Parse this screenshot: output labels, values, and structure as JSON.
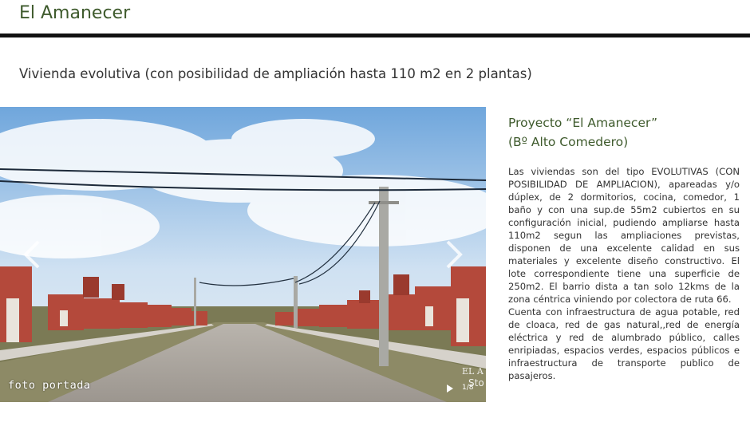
{
  "header": {
    "title": "El Amanecer"
  },
  "subtitle": "Vivienda evolutiva (con posibilidad de ampliación hasta 110 m2 en 2 plantas)",
  "slider": {
    "caption": "foto portada",
    "counter": "1/8",
    "watermark_text": "EL A Sto",
    "prev_icon": "chevron-left-icon",
    "next_icon": "chevron-right-icon",
    "play_icon": "play-icon"
  },
  "project": {
    "title_line1": "Proyecto “El Amanecer”",
    "title_line2": "(Bº Alto Comedero)",
    "paragraph1": "Las viviendas son del tipo EVOLUTIVAS (CON POSIBILIDAD DE AMPLIACION), apareadas y/o dúplex, de 2 dormitorios, cocina, comedor, 1 baño y con una sup.de 55m2 cubiertos en su configuración inicial, pudiendo ampliarse hasta 110m2 segun las ampliaciones previstas, disponen de una excelente calidad en sus materiales y excelente diseño constructivo. El lote correspondiente tiene una superficie de 250m2. El barrio dista  a tan solo 12kms de la zona céntrica viniendo por colectora de ruta 66.",
    "paragraph2": "Cuenta con infraestructura de agua potable, red de cloaca, red de gas natural,,red de energía eléctrica y red de alumbrado público, calles enripiadas, espacios verdes, espacios públicos e infraestructura de transporte publico de pasajeros."
  },
  "colors": {
    "accent_green": "#3e5a2c",
    "rule": "#111111",
    "body_text": "#333333"
  }
}
